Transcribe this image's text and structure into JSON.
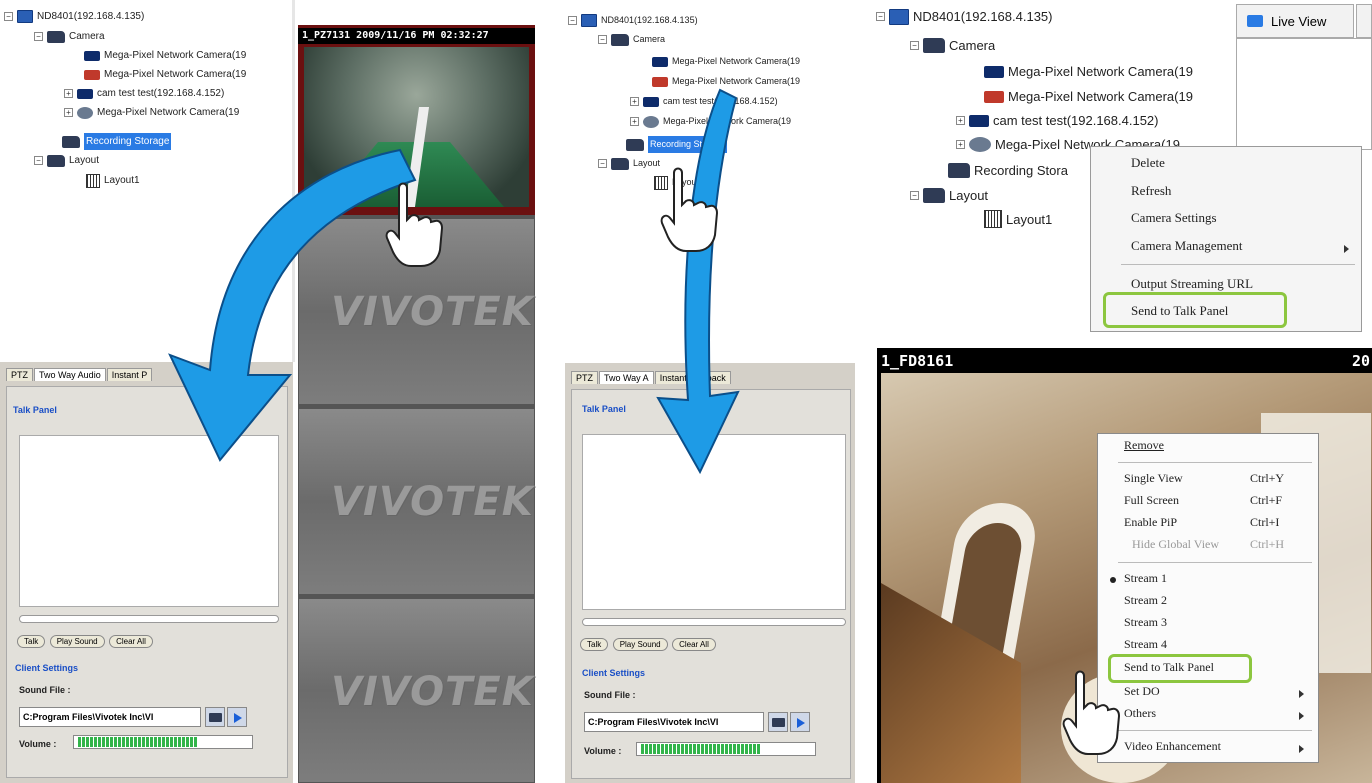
{
  "p1": {
    "tree": {
      "nvr": "ND8401(192.168.4.135)",
      "camera_folder": "Camera",
      "cam1": "Mega-Pixel Network Camera(19",
      "cam2": "Mega-Pixel Network Camera(19",
      "cam3": "cam test test(192.168.4.152)",
      "cam4": "Mega-Pixel Network Camera(19",
      "recording": "Recording Storage",
      "layout_folder": "Layout",
      "layout1": "Layout1"
    },
    "tabs": [
      "PTZ",
      "Two Way Audio",
      "Instant P"
    ],
    "talk_panel": "Talk Panel",
    "buttons": [
      "Talk",
      "Play Sound",
      "Clear All"
    ],
    "client_settings": "Client Settings",
    "sound_file_label": "Sound File :",
    "sound_file_value": "C:Program Files\\Vivotek Inc\\VI",
    "volume_label": "Volume :",
    "video_title": "1_PZ7131 2009/11/16 PM 02:32:27",
    "logo_text": "VIVOTEK"
  },
  "p2": {
    "tree": {
      "nvr": "ND8401(192.168.4.135)",
      "camera_folder": "Camera",
      "cam1": "Mega-Pixel Network Camera(19",
      "cam2": "Mega-Pixel Network Camera(19",
      "cam3": "cam test test(192.168.4.152)",
      "cam4": "Mega-Pixel Network Camera(19",
      "recording": "Recording Storage",
      "layout_folder": "Layout",
      "layout1": "Layout1"
    },
    "tabs": [
      "PTZ",
      "Two Way A",
      "Instant Playback"
    ],
    "talk_panel": "Talk Panel",
    "buttons": [
      "Talk",
      "Play Sound",
      "Clear All"
    ],
    "client_settings": "Client Settings",
    "sound_file_label": "Sound File :",
    "sound_file_value": "C:Program Files\\Vivotek Inc\\VI",
    "volume_label": "Volume :"
  },
  "p3": {
    "tree": {
      "nvr": "ND8401(192.168.4.135)",
      "camera_folder": "Camera",
      "cam1": "Mega-Pixel Network Camera(19",
      "cam2": "Mega-Pixel Network Camera(19",
      "cam3": "cam test test(192.168.4.152)",
      "cam4": "Mega-Pixel Network Camera(19",
      "recording": "Recording Stora",
      "layout_folder": "Layout",
      "layout1": "Layout1"
    },
    "live_view_tab": "Live View",
    "menu": [
      "Delete",
      "Refresh",
      "Camera Settings",
      "Camera Management",
      "Output Streaming URL",
      "Send to Talk Panel"
    ]
  },
  "p4": {
    "video_title": "1_FD8161",
    "video_title_right": "20",
    "menu": {
      "remove": "Remove",
      "single_view": "Single View",
      "single_view_key": "Ctrl+Y",
      "full_screen": "Full Screen",
      "full_screen_key": "Ctrl+F",
      "enable_pip": "Enable PiP",
      "enable_pip_key": "Ctrl+I",
      "hide_global": "Hide Global View",
      "hide_global_key": "Ctrl+H",
      "stream1": "Stream 1",
      "stream2": "Stream 2",
      "stream3": "Stream 3",
      "stream4": "Stream 4",
      "send_talk": "Send to Talk Panel",
      "set_do": "Set DO",
      "others": "Others",
      "video_enh": "Video Enhancement"
    }
  },
  "colors": {
    "arrow": "#1e9be6",
    "highlight": "#8cc63f",
    "selection": "#2a7be4"
  }
}
